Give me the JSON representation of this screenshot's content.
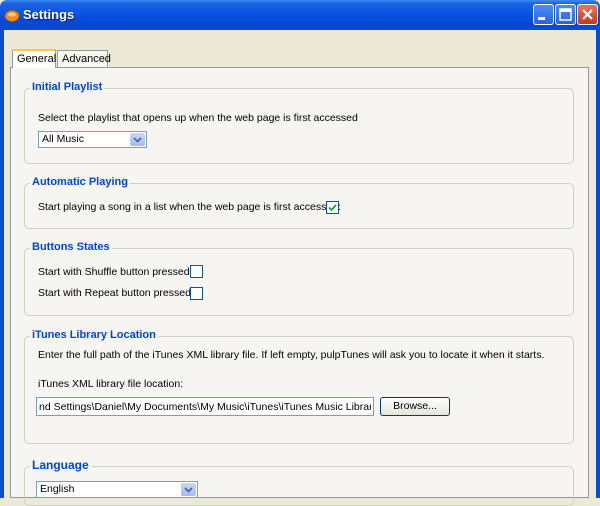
{
  "window": {
    "title": "Settings",
    "icons": {
      "app": "pulptunes-icon",
      "minimize": "minimize-icon",
      "maximize": "maximize-icon",
      "close": "close-icon"
    }
  },
  "tabs": [
    {
      "label": "General",
      "selected": true
    },
    {
      "label": "Advanced",
      "selected": false
    }
  ],
  "initial_playlist": {
    "title": "Initial Playlist",
    "description": "Select the playlist that opens up when the web page is first accessed",
    "selected": "All Music"
  },
  "automatic_playing": {
    "title": "Automatic Playing",
    "label": "Start playing a song in a list when the web page is first accessed:",
    "checked": true
  },
  "buttons_states": {
    "title": "Buttons States",
    "shuffle_label": "Start with Shuffle button pressed:",
    "shuffle_checked": false,
    "repeat_label": "Start with Repeat button pressed:",
    "repeat_checked": false
  },
  "itunes_library": {
    "title": "iTunes Library Location",
    "description": "Enter the full path of the iTunes XML library file. If left empty, pulpTunes will ask you to locate it when it starts.",
    "field_label": "iTunes XML library file location:",
    "path_value": "nd Settings\\Daniel\\My Documents\\My Music\\iTunes\\iTunes Music Library.xml",
    "browse_label": "Browse..."
  },
  "language": {
    "title": "Language",
    "selected": "English"
  },
  "colors": {
    "titlebar": "#0A54E3",
    "legend": "#0046D5",
    "panel": "#F6F5F1",
    "close_button": "#C8381C"
  }
}
